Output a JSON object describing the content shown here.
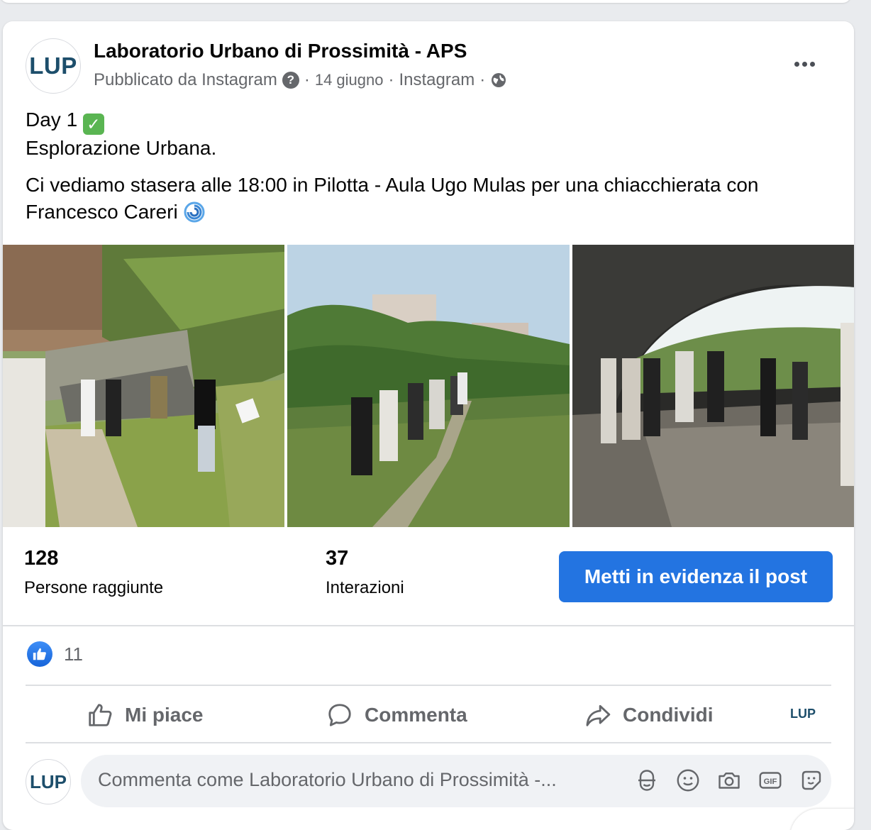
{
  "post": {
    "page_name": "Laboratorio Urbano di Prossimità - APS",
    "avatar_text": "LUP",
    "published_via": "Pubblicato da Instagram",
    "date": "14 giugno",
    "source": "Instagram",
    "privacy_icon": "globe-icon",
    "text_line1": "Day 1",
    "text_line1_emoji": "✅",
    "text_line2": "Esplorazione Urbana.",
    "text_para2": "Ci vediamo stasera alle 18:00 in Pilotta - Aula Ugo Mulas per una chiacchierata con Francesco Careri",
    "text_para2_emoji": "cyclone-emoji"
  },
  "insights": {
    "reach_value": "128",
    "reach_label": "Persone raggiunte",
    "interactions_value": "37",
    "interactions_label": "Interazioni",
    "boost_label": "Metti in evidenza il post"
  },
  "reactions": {
    "like_count": "11"
  },
  "actions": {
    "like": "Mi piace",
    "comment": "Commenta",
    "share": "Condividi",
    "page_switch": "LUP"
  },
  "comment_box": {
    "avatar_text": "LUP",
    "placeholder": "Commenta come Laboratorio Urbano di Prossimità -...",
    "icons": [
      "avatar-sticker-icon",
      "emoji-icon",
      "camera-icon",
      "gif-icon",
      "sticker-icon"
    ]
  },
  "colors": {
    "accent": "#2374e1",
    "muted_text": "#65676b",
    "brand": "#1d4e6b"
  }
}
